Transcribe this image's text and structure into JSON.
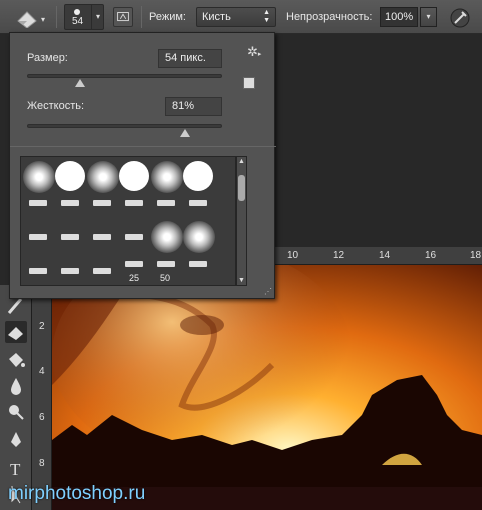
{
  "options_bar": {
    "brush_size": "54",
    "mode_label": "Режим:",
    "mode_value": "Кисть",
    "opacity_label": "Непрозрачность:",
    "opacity_value": "100%"
  },
  "brush_popup": {
    "size_label": "Размер:",
    "size_value": "54 пикс.",
    "size_fraction": 0.27,
    "hardness_label": "Жесткость:",
    "hardness_value": "81%",
    "hardness_fraction": 0.81,
    "preset_numbers": [
      "25",
      "50"
    ]
  },
  "rulers": {
    "top": [
      "10",
      "12",
      "14",
      "16",
      "18"
    ],
    "left": [
      "2",
      "4",
      "6",
      "8"
    ]
  },
  "watermark": "mirphotoshop.ru",
  "colors": {
    "accent": "#7fd0ff",
    "panel": "#535353"
  }
}
